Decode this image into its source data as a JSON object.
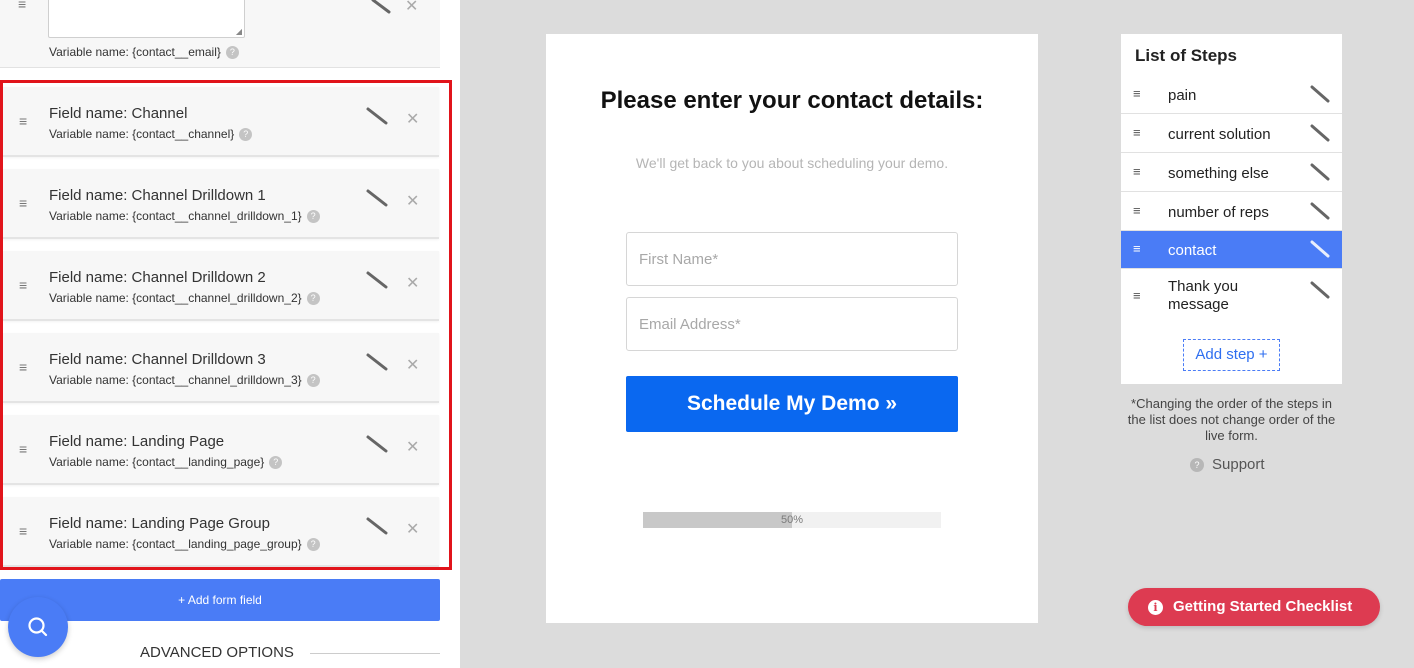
{
  "left_panel": {
    "top_field": {
      "variable": "Variable name: {contact__email}"
    },
    "fields": [
      {
        "name": "Field name: Channel",
        "variable": "Variable name: {contact__channel}"
      },
      {
        "name": "Field name: Channel Drilldown 1",
        "variable": "Variable name: {contact__channel_drilldown_1}"
      },
      {
        "name": "Field name: Channel Drilldown 2",
        "variable": "Variable name: {contact__channel_drilldown_2}"
      },
      {
        "name": "Field name: Channel Drilldown 3",
        "variable": "Variable name: {contact__channel_drilldown_3}"
      },
      {
        "name": "Field name: Landing Page",
        "variable": "Variable name: {contact__landing_page}"
      },
      {
        "name": "Field name: Landing Page Group",
        "variable": "Variable name: {contact__landing_page_group}"
      }
    ],
    "add_field_label": "+ Add form field",
    "advanced_label": "ADVANCED OPTIONS",
    "help_glyph": "?",
    "close_glyph": "✕",
    "drag_glyph": "≡"
  },
  "preview": {
    "title": "Please enter your contact details:",
    "subtitle": "We'll get back to you about scheduling your demo.",
    "first_name_placeholder": "First Name*",
    "email_placeholder": "Email Address*",
    "cta_label": "Schedule My Demo »",
    "progress": {
      "value": 0.5,
      "label": "50%"
    }
  },
  "steps": {
    "heading": "List of Steps",
    "items": [
      {
        "label": "pain",
        "active": false
      },
      {
        "label": "current solution",
        "active": false
      },
      {
        "label": "something else",
        "active": false
      },
      {
        "label": "number of reps",
        "active": false
      },
      {
        "label": "contact",
        "active": true
      },
      {
        "label": "Thank you message",
        "active": false
      }
    ],
    "add_step_label": "Add step +",
    "note": "*Changing the order of the steps in the list does not change order of the live form.",
    "support_label": "Support"
  },
  "checklist": {
    "label": "Getting Started Checklist",
    "info_glyph": "i"
  },
  "colors": {
    "accent": "#4a7cf6",
    "cta": "#0a68f0",
    "highlight": "#e1141b",
    "checklist": "#dd3b51"
  }
}
